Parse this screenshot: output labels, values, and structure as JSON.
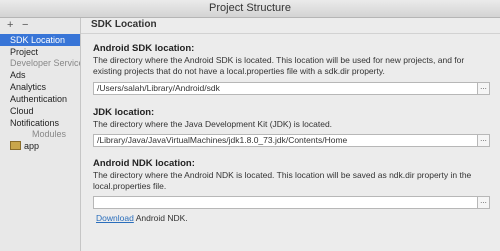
{
  "window": {
    "title": "Project Structure"
  },
  "sidebar": {
    "add": "+",
    "remove": "−",
    "items": [
      {
        "label": "SDK Location"
      },
      {
        "label": "Project"
      }
    ],
    "section_dev": "Developer Services",
    "dev_items": [
      {
        "label": "Ads"
      },
      {
        "label": "Analytics"
      },
      {
        "label": "Authentication"
      },
      {
        "label": "Cloud"
      },
      {
        "label": "Notifications"
      }
    ],
    "section_modules": "Modules",
    "modules": [
      {
        "label": "app"
      }
    ]
  },
  "main": {
    "header": "SDK Location",
    "sdk": {
      "label": "Android SDK location:",
      "desc": "The directory where the Android SDK is located. This location will be used for new projects, and for existing projects that do not have a local.properties file with a sdk.dir property.",
      "value": "/Users/salah/Library/Android/sdk"
    },
    "jdk": {
      "label": "JDK location:",
      "desc": "The directory where the Java Development Kit (JDK) is located.",
      "value": "/Library/Java/JavaVirtualMachines/jdk1.8.0_73.jdk/Contents/Home"
    },
    "ndk": {
      "label": "Android NDK location:",
      "desc": "The directory where the Android NDK is located. This location will be saved as ndk.dir property in the local.properties file.",
      "value": ""
    },
    "browse": "...",
    "download_link": "Download",
    "download_rest": " Android NDK."
  }
}
